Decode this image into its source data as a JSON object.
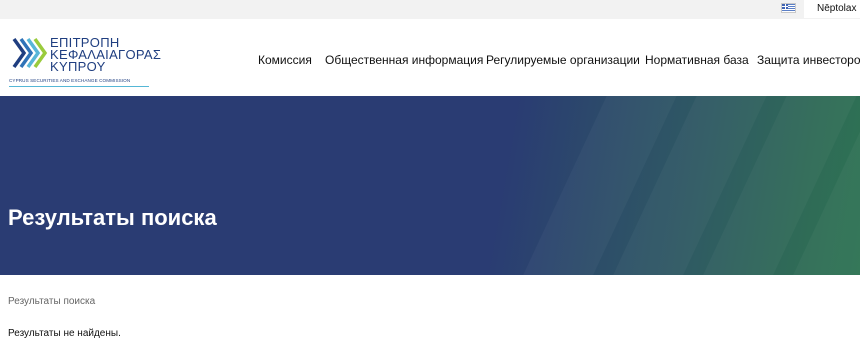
{
  "topbar": {
    "search_placeholder": "Νēptolax",
    "language_flag": "greek-flag"
  },
  "logo": {
    "lines": [
      "ΕΠΙΤΡΟΠΗ",
      "ΚΕΦΑΛΑΙΑΓΟΡΑΣ",
      "ΚΥΠΡΟΥ"
    ],
    "subtitle": "CYPRUS SECURITIES AND EXCHANGE COMMISSION"
  },
  "nav": {
    "items": [
      "Комиссия",
      "Общественная информация",
      "Регулируемые организации",
      "Нормативная база",
      "Защита инвесторов"
    ]
  },
  "hero": {
    "title": "Результаты поиска"
  },
  "breadcrumb": {
    "text": "Результаты поиска"
  },
  "results": {
    "message": "Результаты не найдены."
  },
  "colors": {
    "brand_navy": "#2a3c73",
    "brand_green": "#2e7453",
    "logo_blue": "#1f3e80"
  }
}
